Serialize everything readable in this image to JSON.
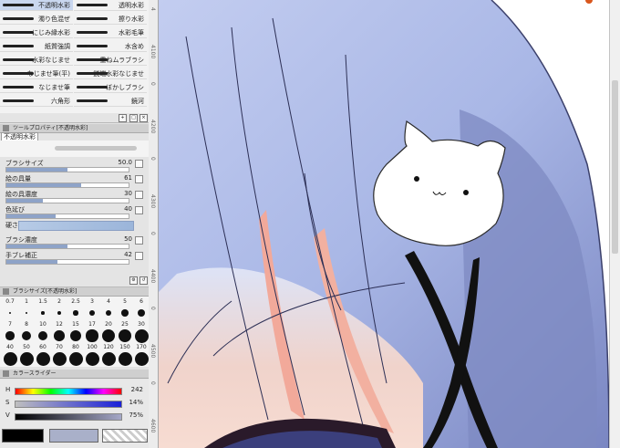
{
  "brushes": {
    "items": [
      {
        "label": "不透明水彩",
        "selected": true
      },
      {
        "label": "透明水彩",
        "selected": false
      },
      {
        "label": "濁り色混ぜ",
        "selected": false
      },
      {
        "label": "擦り水彩",
        "selected": false
      },
      {
        "label": "にじみ縁水彩",
        "selected": false
      },
      {
        "label": "水彩毛筆",
        "selected": false
      },
      {
        "label": "紙質強調",
        "selected": false
      },
      {
        "label": "水含め",
        "selected": false
      },
      {
        "label": "水彩なじませ",
        "selected": false
      },
      {
        "label": "重ねムラブラシ",
        "selected": false
      },
      {
        "label": "なじませ筆(平)",
        "selected": false
      },
      {
        "label": "鋭端水彩なじませ",
        "selected": false
      },
      {
        "label": "なじませ筆",
        "selected": false
      },
      {
        "label": "ぼかしブラシ",
        "selected": false
      },
      {
        "label": "六角形",
        "selected": false
      },
      {
        "label": "鏡河",
        "selected": false
      }
    ]
  },
  "tool_property": {
    "panel_title": "ツールプロパティ[不透明水彩]",
    "brush_name": "不透明水彩",
    "props": [
      {
        "label": "ブラシサイズ",
        "value": "50.0",
        "fill": 0.5
      },
      {
        "label": "絵の具量",
        "value": "61",
        "fill": 0.61
      },
      {
        "label": "絵の具濃度",
        "value": "30",
        "fill": 0.3
      },
      {
        "label": "色延び",
        "value": "40",
        "fill": 0.4
      }
    ],
    "sharpness_label": "硬さ",
    "props2": [
      {
        "label": "ブラシ濃度",
        "value": "50",
        "fill": 0.5
      },
      {
        "label": "手ブレ補正",
        "value": "42",
        "fill": 0.42
      }
    ]
  },
  "brush_size": {
    "panel_title": "ブラシサイズ[不透明水彩]",
    "sizes": [
      "0.7",
      "1",
      "1.5",
      "2",
      "2.5",
      "3",
      "4",
      "5",
      "6",
      "7",
      "8",
      "10",
      "12",
      "15",
      "17",
      "20",
      "25",
      "30",
      "40",
      "50",
      "60",
      "70",
      "80",
      "100",
      "120",
      "150",
      "170"
    ]
  },
  "color_slider": {
    "panel_title": "カラースライダー",
    "rows": [
      {
        "label": "H",
        "value": "242"
      },
      {
        "label": "S",
        "value": "14%"
      },
      {
        "label": "V",
        "value": "75%"
      }
    ]
  },
  "ruler_ticks": [
    "4",
    "4100",
    "0",
    "4200",
    "0",
    "4300",
    "0",
    "4400",
    "0",
    "4500",
    "0",
    "4600"
  ],
  "colors": {
    "accent": "#8ea3c8",
    "hair": "#a9b8e0",
    "hair_dark": "#7784bd",
    "skin": "#f3c3b6"
  }
}
